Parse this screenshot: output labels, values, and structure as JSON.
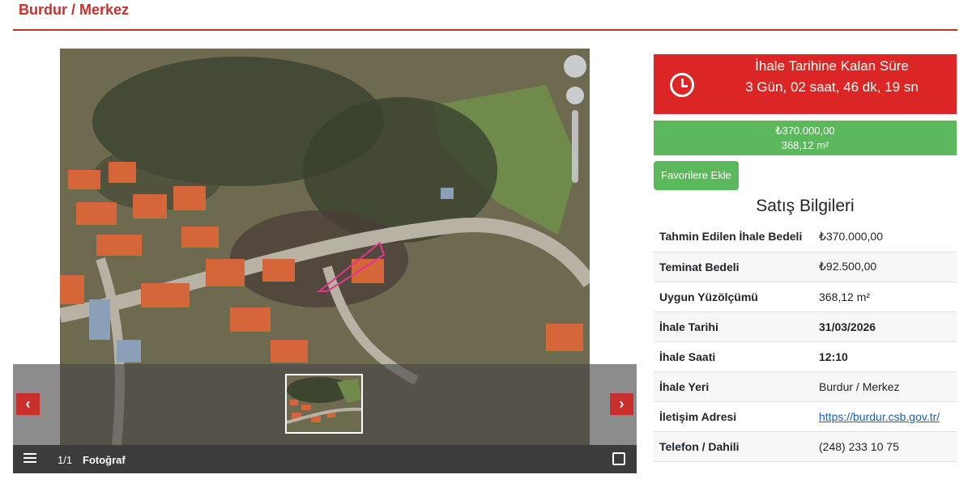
{
  "header": {
    "location_title": "Burdur / Merkez"
  },
  "gallery": {
    "counter": "1/1",
    "label": "Fotoğraf",
    "prev_arrow": "‹",
    "next_arrow": "›",
    "icons": [
      "list-icon",
      "expand-icon",
      "chevron-left-icon",
      "chevron-right-icon"
    ]
  },
  "countdown": {
    "title": "İhale Tarihine Kalan Süre",
    "time": "3 Gün, 02 saat, 46 dk, 19 sn",
    "icon": "clock-icon"
  },
  "price": {
    "amount": "₺370.000,00",
    "area": "368,12 m²"
  },
  "favorite_button": "Favorilere Ekle",
  "section_title": "Satış Bilgileri",
  "info_rows": [
    {
      "label": "Tahmin Edilen İhale Bedeli",
      "value": "₺370.000,00"
    },
    {
      "label": "Teminat Bedeli",
      "value": "₺92.500,00"
    },
    {
      "label": "Uygun Yüzölçümü",
      "value": "368,12 m²"
    },
    {
      "label": "İhale Tarihi",
      "value": "31/03/2026"
    },
    {
      "label": "İhale Saati",
      "value": "12:10"
    },
    {
      "label": "İhale Yeri",
      "value": "Burdur / Merkez"
    },
    {
      "label": "İletişim Adresi",
      "value": "https://burdur.csb.gov.tr/"
    },
    {
      "label": "Telefon / Dahili",
      "value": "(248) 233 10 75"
    }
  ],
  "colors": {
    "accent_red": "#c9302c",
    "countdown_red": "#dc2626",
    "green": "#5cb85c"
  }
}
